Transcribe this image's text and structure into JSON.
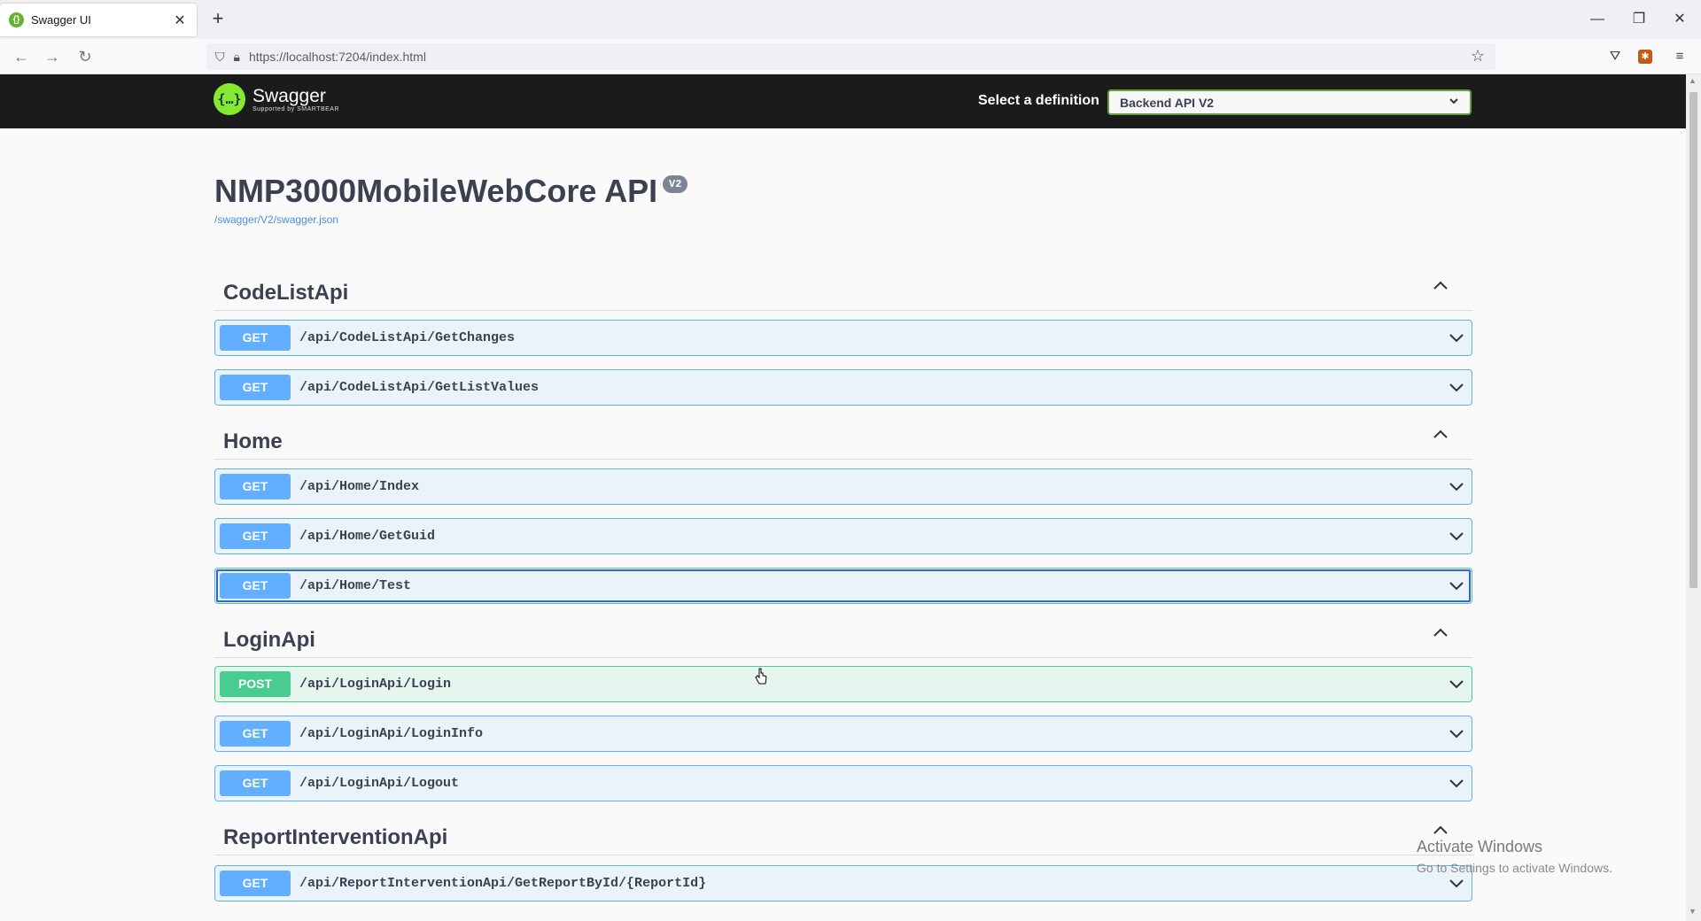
{
  "browser": {
    "tab_title": "Swagger UI",
    "tab_close": "✕",
    "new_tab": "+",
    "url": "https://localhost:7204/index.html",
    "window_controls": {
      "minimize": "—",
      "restore": "❐",
      "close": "✕"
    }
  },
  "swagger": {
    "logo_name": "Swagger",
    "logo_sub": "Supported by SMARTBEAR",
    "definition_label": "Select a definition",
    "definition_selected": "Backend API V2"
  },
  "api": {
    "title": "NMP3000MobileWebCore API",
    "version": "V2",
    "spec_link": "/swagger/V2/swagger.json"
  },
  "groups": [
    {
      "name": "CodeListApi",
      "operations": [
        {
          "method": "GET",
          "path": "/api/CodeListApi/GetChanges"
        },
        {
          "method": "GET",
          "path": "/api/CodeListApi/GetListValues"
        }
      ]
    },
    {
      "name": "Home",
      "operations": [
        {
          "method": "GET",
          "path": "/api/Home/Index"
        },
        {
          "method": "GET",
          "path": "/api/Home/GetGuid"
        },
        {
          "method": "GET",
          "path": "/api/Home/Test"
        }
      ]
    },
    {
      "name": "LoginApi",
      "operations": [
        {
          "method": "POST",
          "path": "/api/LoginApi/Login"
        },
        {
          "method": "GET",
          "path": "/api/LoginApi/LoginInfo"
        },
        {
          "method": "GET",
          "path": "/api/LoginApi/Logout"
        }
      ]
    },
    {
      "name": "ReportInterventionApi",
      "operations": [
        {
          "method": "GET",
          "path": "/api/ReportInterventionApi/GetReportById/{ReportId}"
        }
      ]
    }
  ],
  "watermark": {
    "title": "Activate Windows",
    "subtitle": "Go to Settings to activate Windows."
  },
  "colors": {
    "get": "#61affe",
    "post": "#49cc90",
    "topbar": "#1b1b1b",
    "logo": "#85ea2d"
  }
}
